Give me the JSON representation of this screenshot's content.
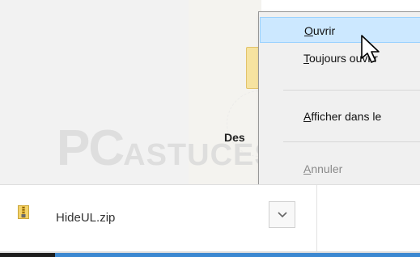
{
  "background": {
    "folder_label": "Des",
    "watermark_main": "PC",
    "watermark_sub": "ASTUCES"
  },
  "context_menu": {
    "items": [
      {
        "label": "Ouvrir",
        "mnemonic": "O",
        "rest": "uvrir",
        "state": "hover"
      },
      {
        "label": "Toujours ouvrir",
        "mnemonic": "T",
        "rest": "oujours ouvrir",
        "state": "normal"
      },
      {
        "label": "Afficher dans le",
        "mnemonic": "A",
        "rest": "fficher dans le",
        "state": "normal"
      },
      {
        "label": "Annuler",
        "mnemonic": "A",
        "rest": "nnuler",
        "state": "disabled"
      }
    ]
  },
  "download_bar": {
    "file_name": "HideUL.zip",
    "file_icon": "zip-file-icon",
    "dropdown_icon": "chevron-down-icon"
  },
  "colors": {
    "menu_hover": "#cce8ff",
    "menu_bg": "#f0f0f0",
    "taskbar_blue": "#3c88d1"
  }
}
